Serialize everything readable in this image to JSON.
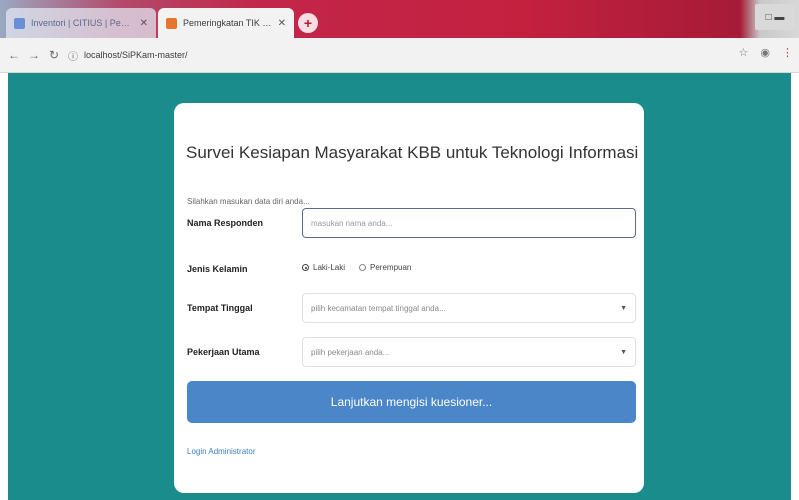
{
  "browser": {
    "tabs": [
      {
        "title": "Inventori | CITIUS | Pengelolaan",
        "active": false
      },
      {
        "title": "Pemeringkatan TIK KBB",
        "active": true
      }
    ],
    "new_tab_symbol": "+",
    "url": "localhost/SiPKam-master/",
    "window_controls": "□ ▬"
  },
  "survey": {
    "title": "Survei Kesiapan Masyarakat KBB untuk Teknologi Informasi",
    "instruction": "Silahkan masukan data diri anda...",
    "fields": {
      "name": {
        "label": "Nama Responden",
        "placeholder": "masukan nama anda..."
      },
      "gender": {
        "label": "Jenis Kelamin",
        "options": [
          {
            "label": "Laki-Laki",
            "checked": true
          },
          {
            "label": "Perempuan",
            "checked": false
          }
        ]
      },
      "residence": {
        "label": "Tempat Tinggal",
        "placeholder": "pilih kecamatan tempat tinggal anda..."
      },
      "occupation": {
        "label": "Pekerjaan Utama",
        "placeholder": "pilih pekerjaan anda..."
      }
    },
    "submit_label": "Lanjutkan mengisi kuesioner...",
    "admin_link": "Login Administrator"
  },
  "colors": {
    "page_background": "#1b8c8c",
    "button": "#4b86c9",
    "link": "#3f7fbf"
  }
}
